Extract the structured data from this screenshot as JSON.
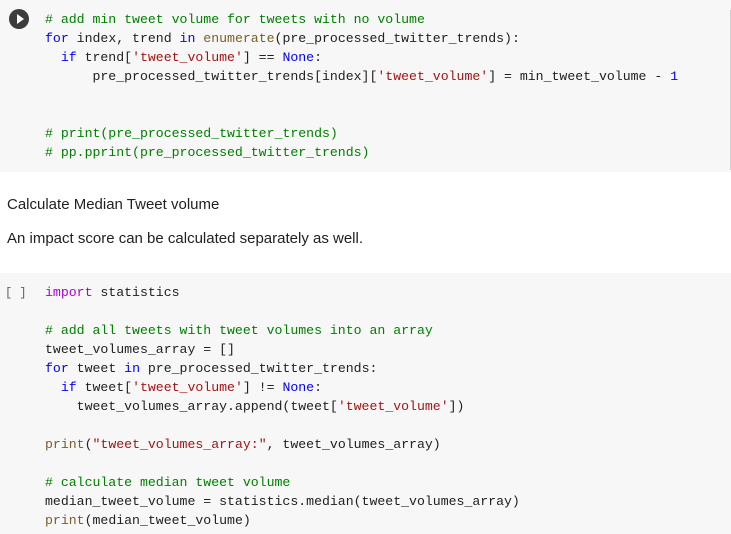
{
  "cell1": {
    "lines": [
      "# add min tweet volume for tweets with no volume",
      "for index, trend in enumerate(pre_processed_twitter_trends):",
      "  if trend['tweet_volume'] == None:",
      "      pre_processed_twitter_trends[index]['tweet_volume'] = min_tweet_volume - 1",
      "",
      "",
      "# print(pre_processed_twitter_trends)",
      "# pp.pprint(pre_processed_twitter_trends)"
    ]
  },
  "text_cells": {
    "heading": "Calculate Median Tweet volume",
    "paragraph": "An impact score can be calculated separately as well."
  },
  "cell2": {
    "exec_count": "[ ]",
    "lines": [
      "import statistics",
      "",
      "# add all tweets with tweet volumes into an array",
      "tweet_volumes_array = []",
      "for tweet in pre_processed_twitter_trends:",
      "  if tweet['tweet_volume'] != None:",
      "    tweet_volumes_array.append(tweet['tweet_volume'])",
      "",
      "print(\"tweet_volumes_array:\", tweet_volumes_array)",
      "",
      "# calculate median tweet volume",
      "median_tweet_volume = statistics.median(tweet_volumes_array)",
      "print(median_tweet_volume)"
    ]
  },
  "colors": {
    "keyword": "#0000ff",
    "builtin": "#795e26",
    "string": "#a31515",
    "comment": "#008000",
    "cell_background": "#f7f7f7"
  }
}
